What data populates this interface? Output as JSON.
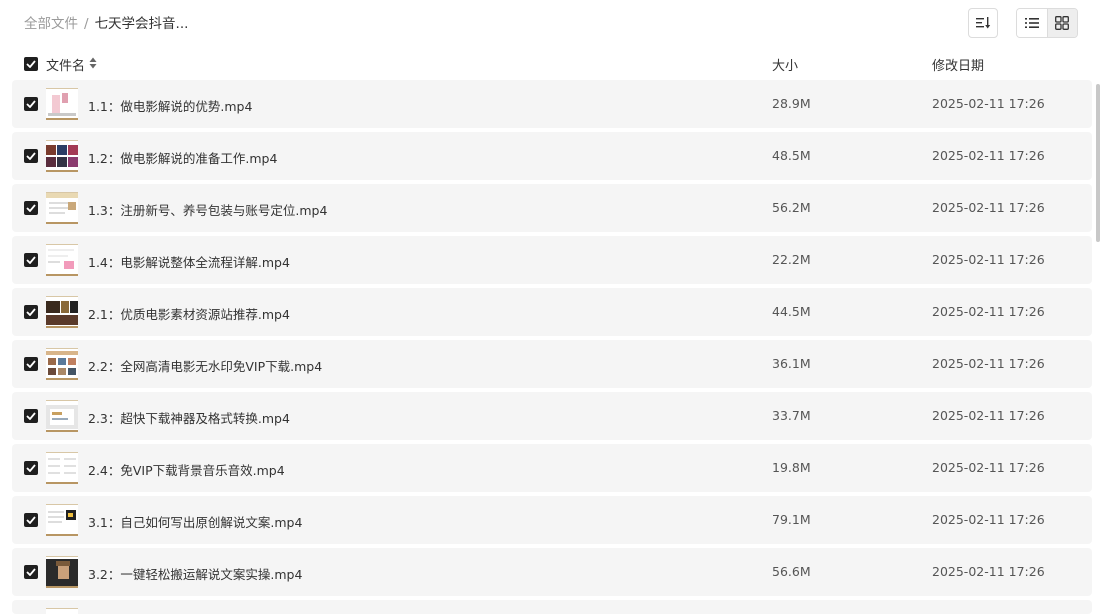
{
  "breadcrumb": {
    "root": "全部文件",
    "separator": "/",
    "current": "七天学会抖音..."
  },
  "header": {
    "name_col": "文件名",
    "size_col": "大小",
    "date_col": "修改日期"
  },
  "files": [
    {
      "name": "1.1：做电影解说的优势.mp4",
      "size": "28.9M",
      "date": "2025-02-11 17:26",
      "thumb": "pink"
    },
    {
      "name": "1.2：做电影解说的准备工作.mp4",
      "size": "48.5M",
      "date": "2025-02-11 17:26",
      "thumb": "posters"
    },
    {
      "name": "1.3：注册新号、养号包装与账号定位.mp4",
      "size": "56.2M",
      "date": "2025-02-11 17:26",
      "thumb": "doc"
    },
    {
      "name": "1.4：电影解说整体全流程详解.mp4",
      "size": "22.2M",
      "date": "2025-02-11 17:26",
      "thumb": "doc-pink"
    },
    {
      "name": "2.1：优质电影素材资源站推荐.mp4",
      "size": "44.5M",
      "date": "2025-02-11 17:26",
      "thumb": "dark"
    },
    {
      "name": "2.2：全网高清电影无水印免VIP下载.mp4",
      "size": "36.1M",
      "date": "2025-02-11 17:26",
      "thumb": "grid"
    },
    {
      "name": "2.3：超快下载神器及格式转换.mp4",
      "size": "33.7M",
      "date": "2025-02-11 17:26",
      "thumb": "window"
    },
    {
      "name": "2.4：免VIP下载背景音乐音效.mp4",
      "size": "19.8M",
      "date": "2025-02-11 17:26",
      "thumb": "list"
    },
    {
      "name": "3.1：自己如何写出原创解说文案.mp4",
      "size": "79.1M",
      "date": "2025-02-11 17:26",
      "thumb": "text"
    },
    {
      "name": "3.2：一键轻松搬运解说文案实操.mp4",
      "size": "56.6M",
      "date": "2025-02-11 17:26",
      "thumb": "face"
    }
  ]
}
